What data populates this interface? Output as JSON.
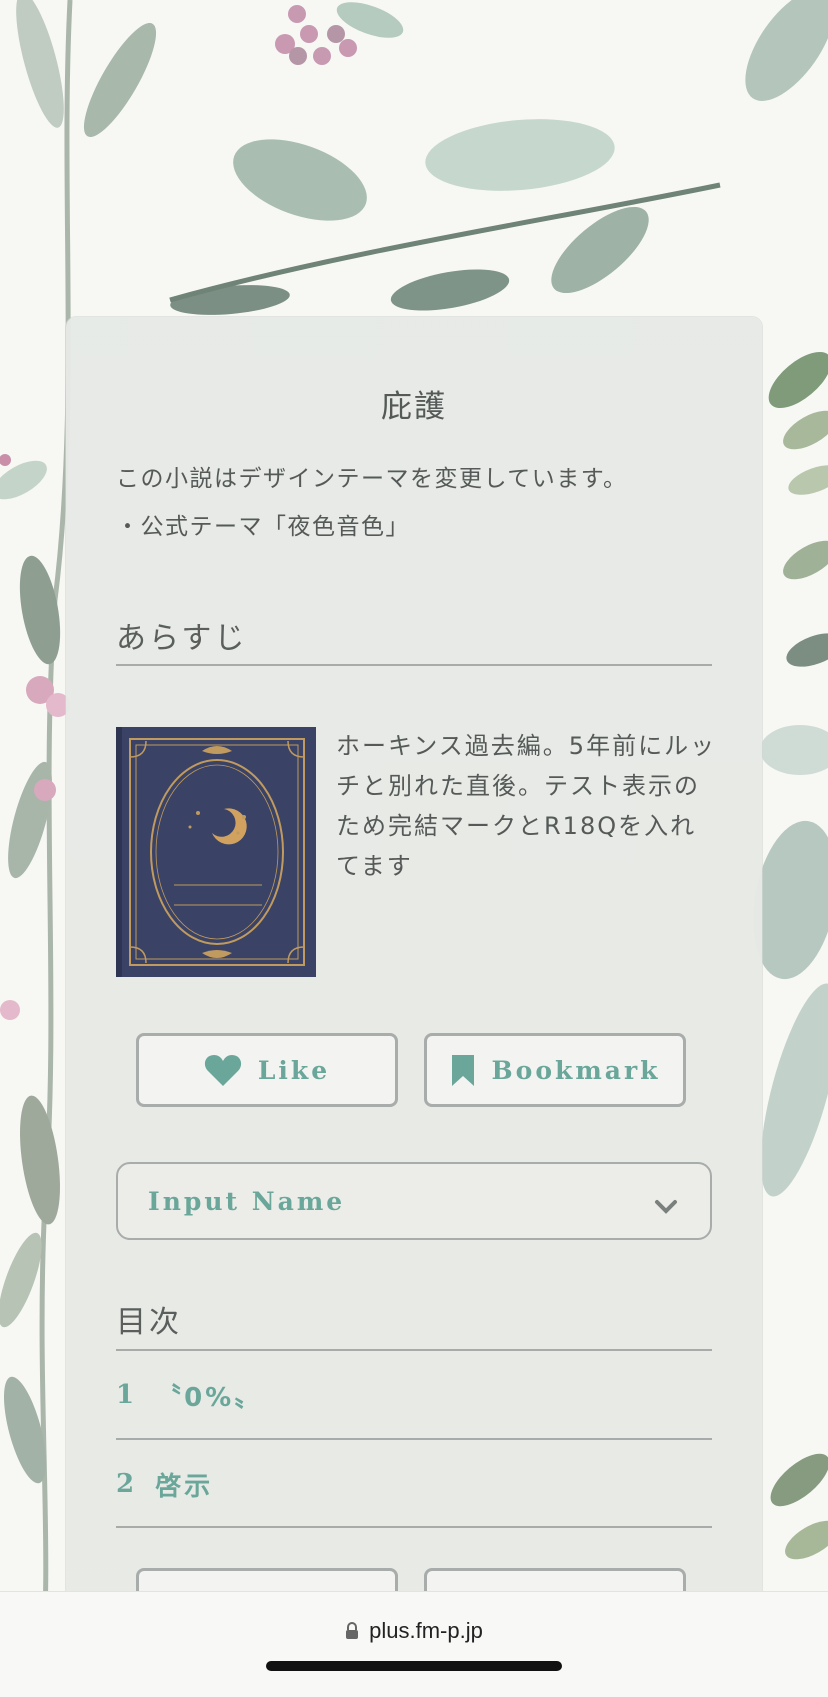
{
  "novel": {
    "title": "庇護",
    "notice_line1": "この小説はデザインテーマを変更しています。",
    "notice_line2": "・公式テーマ「夜色音色」"
  },
  "synopsis": {
    "heading": "あらすじ",
    "text": "ホーキンス過去編。5年前にルッチと別れた直後。テスト表示のため完結マークとR18Qを入れてます",
    "cover_icon": "moon-book-cover"
  },
  "actions": {
    "like_label": "Like",
    "bookmark_label": "Bookmark",
    "like_icon": "heart-icon",
    "bookmark_icon": "bookmark-icon"
  },
  "name_select": {
    "selected": "Input Name"
  },
  "toc": {
    "heading": "目次",
    "items": [
      {
        "num": "1",
        "title": "〝0%〟"
      },
      {
        "num": "2",
        "title": "啓示"
      }
    ]
  },
  "browser": {
    "url": "plus.fm-p.jp"
  },
  "colors": {
    "accent": "#6aa79a",
    "text": "#555a58",
    "cover": "#3a4266",
    "cover_gold": "#c09a5e"
  }
}
